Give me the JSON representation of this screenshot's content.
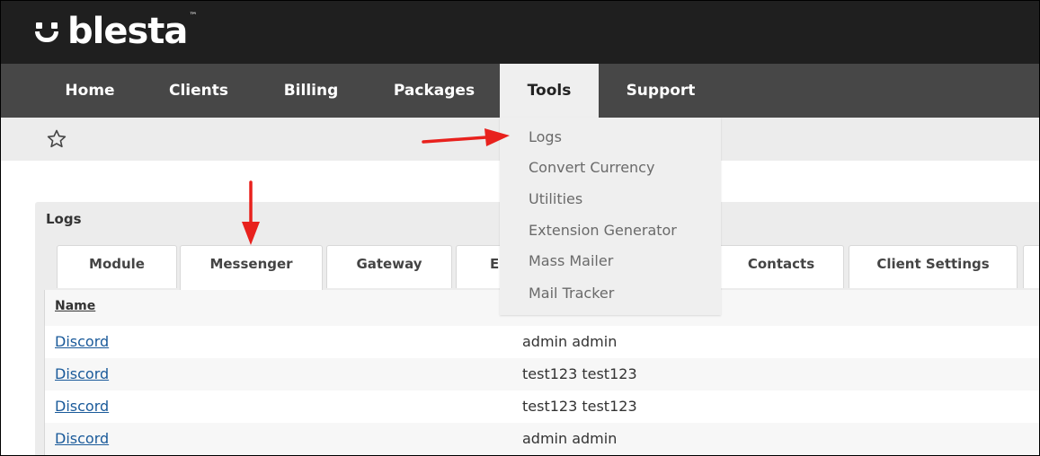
{
  "brand": {
    "logo_text": "blesta",
    "trademark": "™"
  },
  "nav": {
    "items": [
      {
        "label": "Home",
        "active": false
      },
      {
        "label": "Clients",
        "active": false
      },
      {
        "label": "Billing",
        "active": false
      },
      {
        "label": "Packages",
        "active": false
      },
      {
        "label": "Tools",
        "active": true
      },
      {
        "label": "Support",
        "active": false
      }
    ]
  },
  "favorites": {
    "icon": "star-outline-icon"
  },
  "tools_menu": {
    "items": [
      "Logs",
      "Convert Currency",
      "Utilities",
      "Extension Generator",
      "Mass Mailer",
      "Mail Tracker"
    ]
  },
  "logs_panel": {
    "title": "Logs",
    "tabs": [
      {
        "label": "Module",
        "active": false
      },
      {
        "label": "Messenger",
        "active": true
      },
      {
        "label": "Gateway",
        "active": false
      },
      {
        "label": "E",
        "active": false
      },
      {
        "label": "Contacts",
        "active": false
      },
      {
        "label": "Client Settings",
        "active": false
      }
    ],
    "table": {
      "header_name": "Name",
      "rows": [
        {
          "name": "Discord",
          "user": "admin admin"
        },
        {
          "name": "Discord",
          "user": "test123 test123"
        },
        {
          "name": "Discord",
          "user": "test123 test123"
        },
        {
          "name": "Discord",
          "user": "admin admin"
        }
      ]
    }
  },
  "colors": {
    "topbar": "#1f1f1f",
    "nav": "#474747",
    "active_nav": "#efefef",
    "link": "#1a5a9a",
    "annotation_arrow": "#e8211d"
  }
}
